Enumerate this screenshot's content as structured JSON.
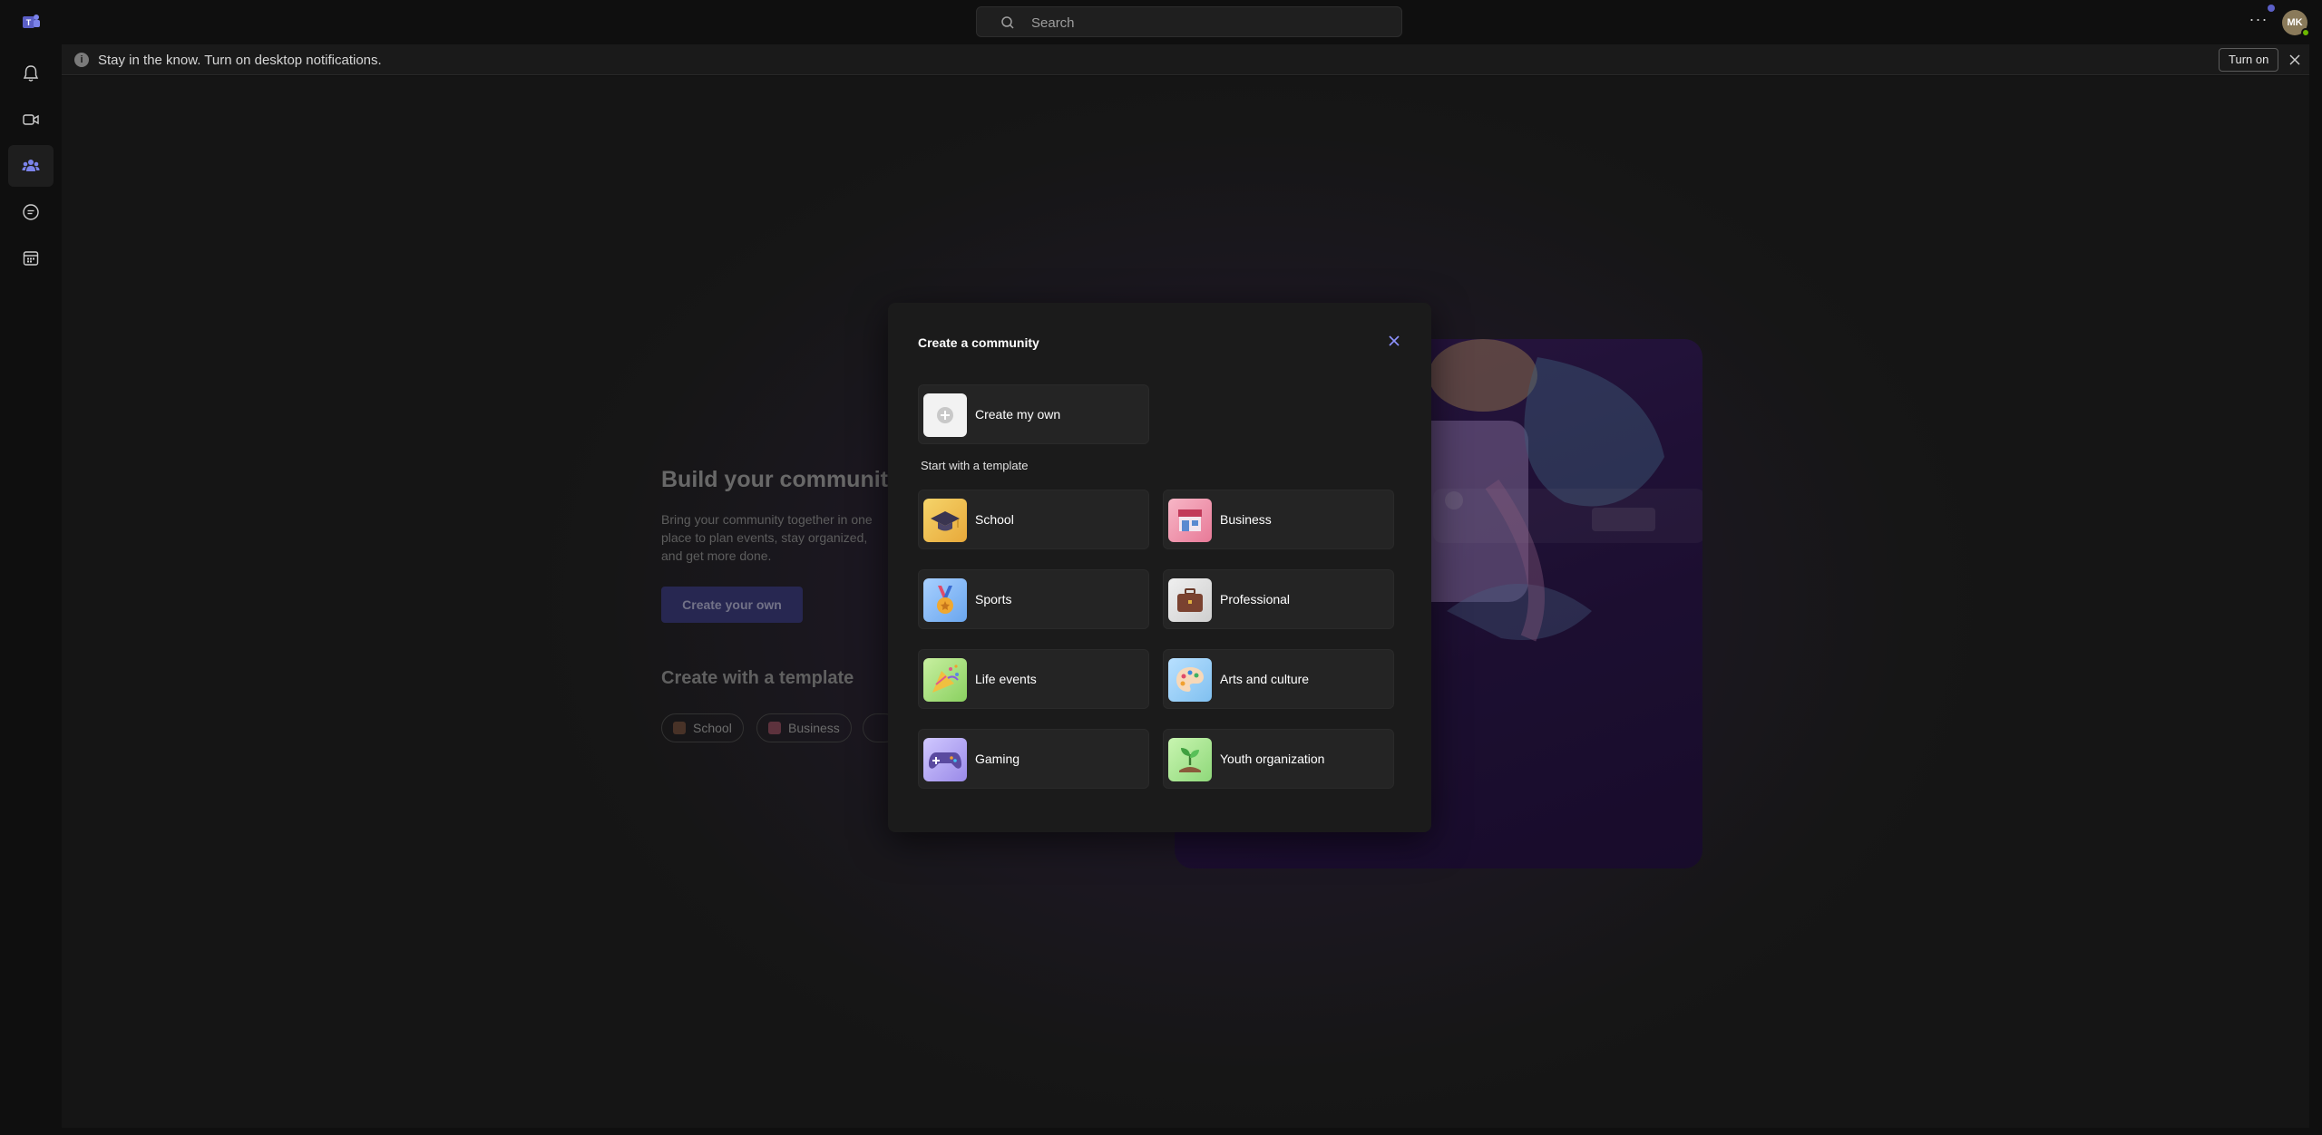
{
  "search": {
    "placeholder": "Search"
  },
  "user": {
    "initials": "MK"
  },
  "notification": {
    "message": "Stay in the know. Turn on desktop notifications.",
    "action_label": "Turn on"
  },
  "background": {
    "title": "Build your community",
    "description": "Bring your community together in one place to plan events, stay organized, and get more done.",
    "create_button": "Create your own",
    "template_heading": "Create with a template",
    "chips": [
      "School",
      "Business"
    ]
  },
  "modal": {
    "title": "Create a community",
    "create_own_label": "Create my own",
    "section_label": "Start with a template",
    "templates": [
      {
        "label": "School",
        "icon": "graduation-cap-icon"
      },
      {
        "label": "Business",
        "icon": "storefront-icon"
      },
      {
        "label": "Sports",
        "icon": "medal-icon"
      },
      {
        "label": "Professional",
        "icon": "briefcase-icon"
      },
      {
        "label": "Life events",
        "icon": "party-popper-icon"
      },
      {
        "label": "Arts and culture",
        "icon": "palette-icon"
      },
      {
        "label": "Gaming",
        "icon": "game-controller-icon"
      },
      {
        "label": "Youth organization",
        "icon": "seedling-icon"
      }
    ]
  },
  "colors": {
    "accent": "#5b5fc7",
    "presence": "#6bb700"
  }
}
